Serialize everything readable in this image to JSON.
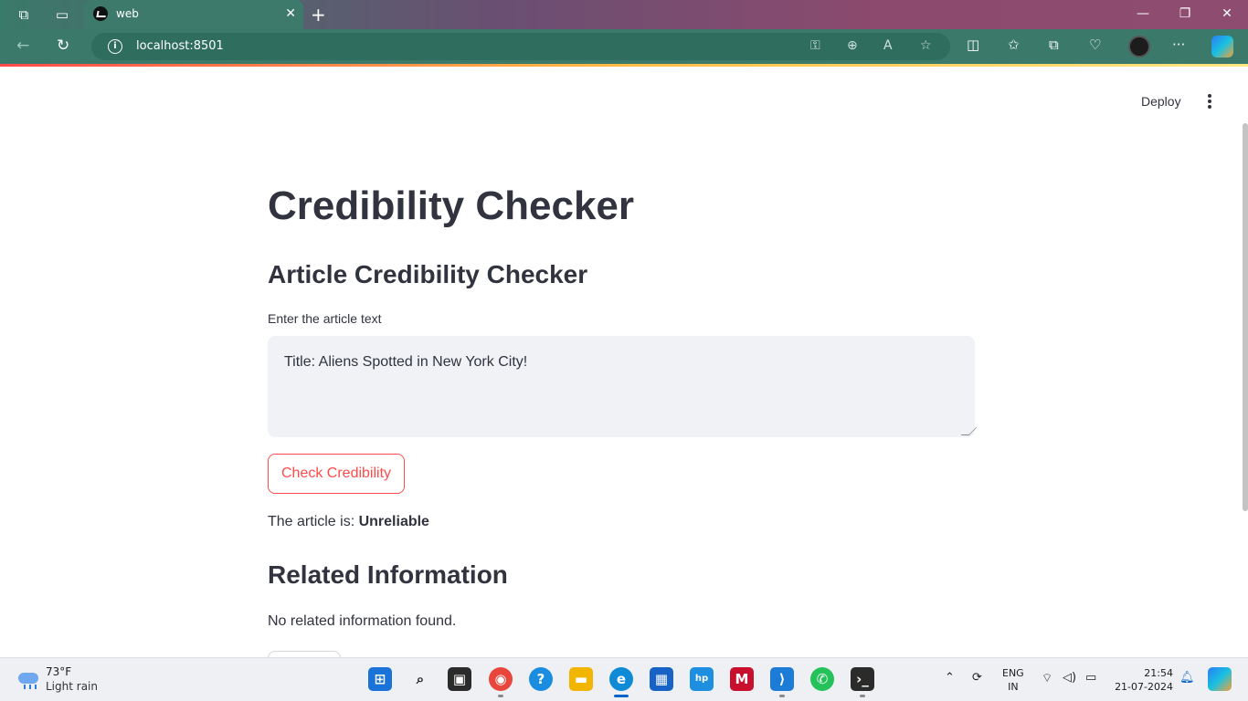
{
  "browser": {
    "tab_title": "web",
    "url": "localhost:8501",
    "tab_close_glyph": "✕",
    "new_tab_glyph": "+"
  },
  "app_header": {
    "deploy_label": "Deploy"
  },
  "main": {
    "title": "Credibility Checker",
    "subtitle": "Article Credibility Checker",
    "input_label": "Enter the article text",
    "input_value": "Title: Aliens Spotted in New York City!",
    "check_button": "Check Credibility",
    "result_prefix": "The article is: ",
    "result_value": "Unreliable",
    "related_heading": "Related Information",
    "related_text": "No related information found."
  },
  "taskbar": {
    "weather_temp": "73°F",
    "weather_desc": "Light rain",
    "lang_top": "ENG",
    "lang_bottom": "IN",
    "time": "21:54",
    "date": "21-07-2024"
  },
  "colors": {
    "accent": "#ff4b4b",
    "text": "#31333f",
    "input_bg": "#f0f2f6",
    "browser_frame": "#3b7a6b"
  },
  "icons": {
    "workspaces": "workspaces-icon",
    "tab_actions": "tab-actions-icon",
    "back": "back-arrow-icon",
    "refresh": "refresh-icon",
    "info": "site-info-icon",
    "favorites": "star-icon",
    "menu": "kebab-menu-icon"
  }
}
